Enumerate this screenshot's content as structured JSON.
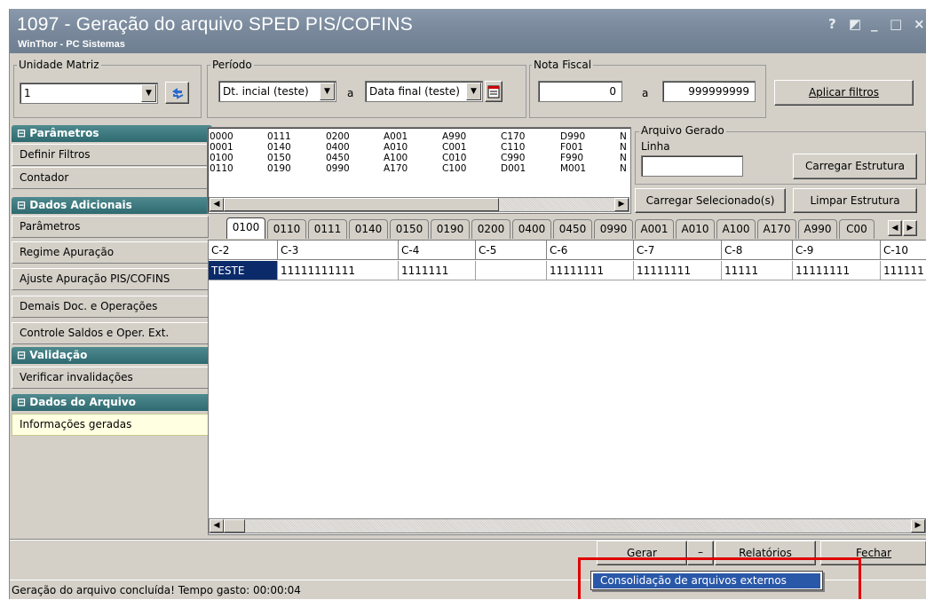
{
  "window": {
    "title": "1097 - Geração do arquivo SPED PIS/COFINS",
    "subtitle": "WinThor - PC Sistemas",
    "controls": [
      "?",
      "◩",
      "_",
      "□",
      "×"
    ]
  },
  "filters": {
    "unidade_label": "Unidade Matriz",
    "unidade_value": "1",
    "periodo_label": "Período",
    "data_inicial": "Dt. incial (teste)",
    "a1": "a",
    "data_final": "Data final (teste)",
    "nota_label": "Nota Fiscal",
    "nota_from": "0",
    "a2": "a",
    "nota_to": "999999999",
    "apply_label": "Aplicar filtros"
  },
  "sidebar": {
    "sections": [
      {
        "title": "Parâmetros",
        "items": [
          "Definir Filtros",
          "Contador"
        ]
      },
      {
        "title": "Dados Adicionais",
        "items": [
          "Parâmetros",
          "Regime Apuração",
          "Ajuste Apuração PIS/COFINS",
          "Demais Doc. e Operações",
          "Controle Saldos e Oper. Ext."
        ]
      },
      {
        "title": "Validação",
        "items": [
          "Verificar invalidações"
        ]
      },
      {
        "title": "Dados do Arquivo",
        "items": [
          "Informações geradas"
        ]
      }
    ]
  },
  "tree": {
    "columns": [
      [
        "0000",
        "0001",
        "0100",
        "0110"
      ],
      [
        "0111",
        "0140",
        "0150",
        "0190"
      ],
      [
        "0200",
        "0400",
        "0450",
        "0990"
      ],
      [
        "A001",
        "A010",
        "A100",
        "A170"
      ],
      [
        "A990",
        "C001",
        "C010",
        "C100"
      ],
      [
        "C170",
        "C110",
        "C990",
        "D001"
      ],
      [
        "D990",
        "F001",
        "F990",
        "M001"
      ],
      [
        "N",
        "N",
        "N",
        "N"
      ]
    ]
  },
  "arquivo": {
    "label": "Arquivo Gerado",
    "linha_label": "Linha",
    "linha_value": "",
    "carregar_estrutura": "Carregar Estrutura",
    "carregar_selecionados": "Carregar Selecionado(s)",
    "limpar_estrutura": "Limpar Estrutura"
  },
  "tabs": [
    "0100",
    "0110",
    "0111",
    "0140",
    "0150",
    "0190",
    "0200",
    "0400",
    "0450",
    "0990",
    "A001",
    "A010",
    "A100",
    "A170",
    "A990",
    "C00"
  ],
  "grid": {
    "headers": [
      "C-2",
      "C-3",
      "C-4",
      "C-5",
      "C-6",
      "C-7",
      "C-8",
      "C-9",
      "C-10"
    ],
    "rows": [
      [
        "TESTE",
        "11111111111",
        "1111111",
        "",
        "11111111",
        "11111111",
        "11111",
        "11111111",
        "111111"
      ]
    ]
  },
  "actions": {
    "gerar": "Gerar",
    "relatorios": "Relatórios",
    "fechar": "Fechar"
  },
  "popup": {
    "item": "Consolidação de arquivos externos"
  },
  "status": "Geração do arquivo concluída! Tempo gasto: 00:00:04"
}
